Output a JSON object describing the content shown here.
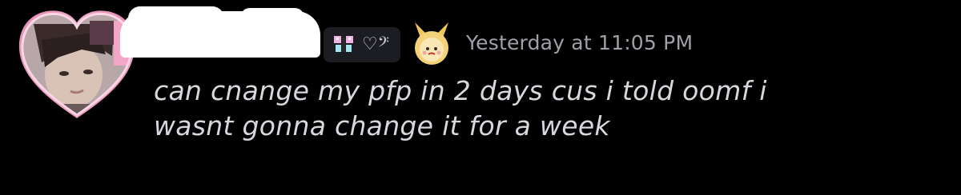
{
  "message": {
    "timestamp": "Yesterday at 11:05 PM",
    "content_lines": [
      "can cnange my pfp in 2 days cus i told oomf i",
      "wasnt gonna change it for a week"
    ],
    "clan_tag": {
      "icon": "butterfly-icon",
      "symbol": "♡𝄢"
    },
    "decoration_badge": "bunny-hood-icon"
  },
  "colors": {
    "background": "#000000",
    "timestamp": "#9fa1a8",
    "text": "#d7d8de",
    "avatar_frame": "#f4a6c7"
  }
}
